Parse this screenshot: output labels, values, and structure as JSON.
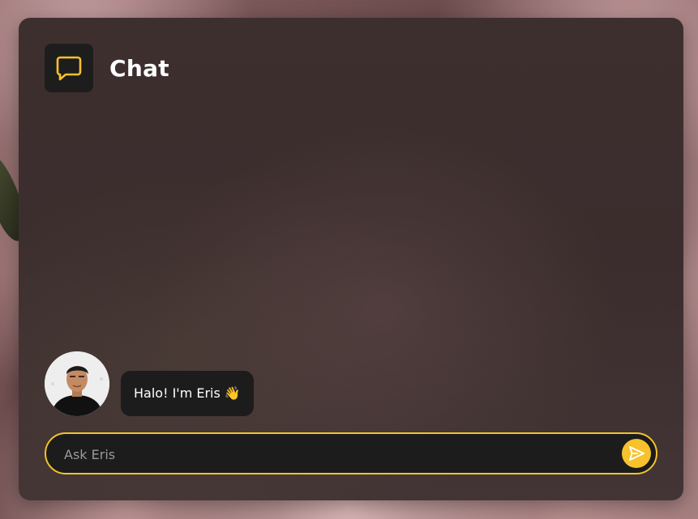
{
  "app": {
    "title": "Chat"
  },
  "header": {
    "icon": "chat-bubble-icon",
    "title": "Chat",
    "icon_color": "#f7c22b",
    "icon_bg": "#1d1d1d"
  },
  "messages": [
    {
      "sender_avatar": "avatar-photo",
      "text": "Halo! I'm Eris 👋"
    }
  ],
  "composer": {
    "placeholder": "Ask Eris",
    "value": "",
    "send_icon": "send-icon",
    "accent_color": "#f2c42b"
  }
}
